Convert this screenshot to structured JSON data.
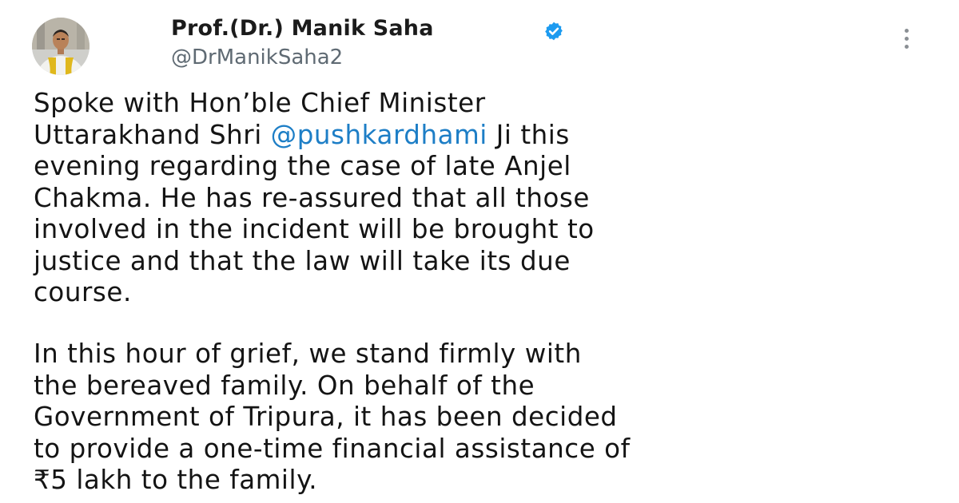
{
  "author": {
    "name": "Prof.(Dr.) Manik Saha",
    "handle": "@DrManikSaha2",
    "verified": true,
    "avatar": "profile-photo"
  },
  "tweet": {
    "paragraph1": {
      "line1": "Spoke with Hon’ble Chief Minister",
      "line2_before": "Uttarakhand Shri ",
      "line2_mention": "@pushkardhami",
      "line2_after": " Ji this",
      "line3": "evening regarding the case of late Anjel",
      "line4": "Chakma. He has re-assured that all those",
      "line5": "involved in the incident will be brought to",
      "line6": "justice and that the law will take its due",
      "line7": "course."
    },
    "paragraph2": {
      "line1": "In this hour of grief, we stand firmly with",
      "line2": "the bereaved family. On behalf of the",
      "line3": "Government of Tripura, it has been decided",
      "line4": "to provide a one-time financial assistance of",
      "line5": "₹5 lakh to the family."
    }
  },
  "colors": {
    "mention": "#1d7ec6",
    "verified_badge": "#1d9bf0",
    "handle": "#5f6a73"
  },
  "icons": {
    "verified": "verified-badge-icon",
    "more": "more-options-icon"
  }
}
